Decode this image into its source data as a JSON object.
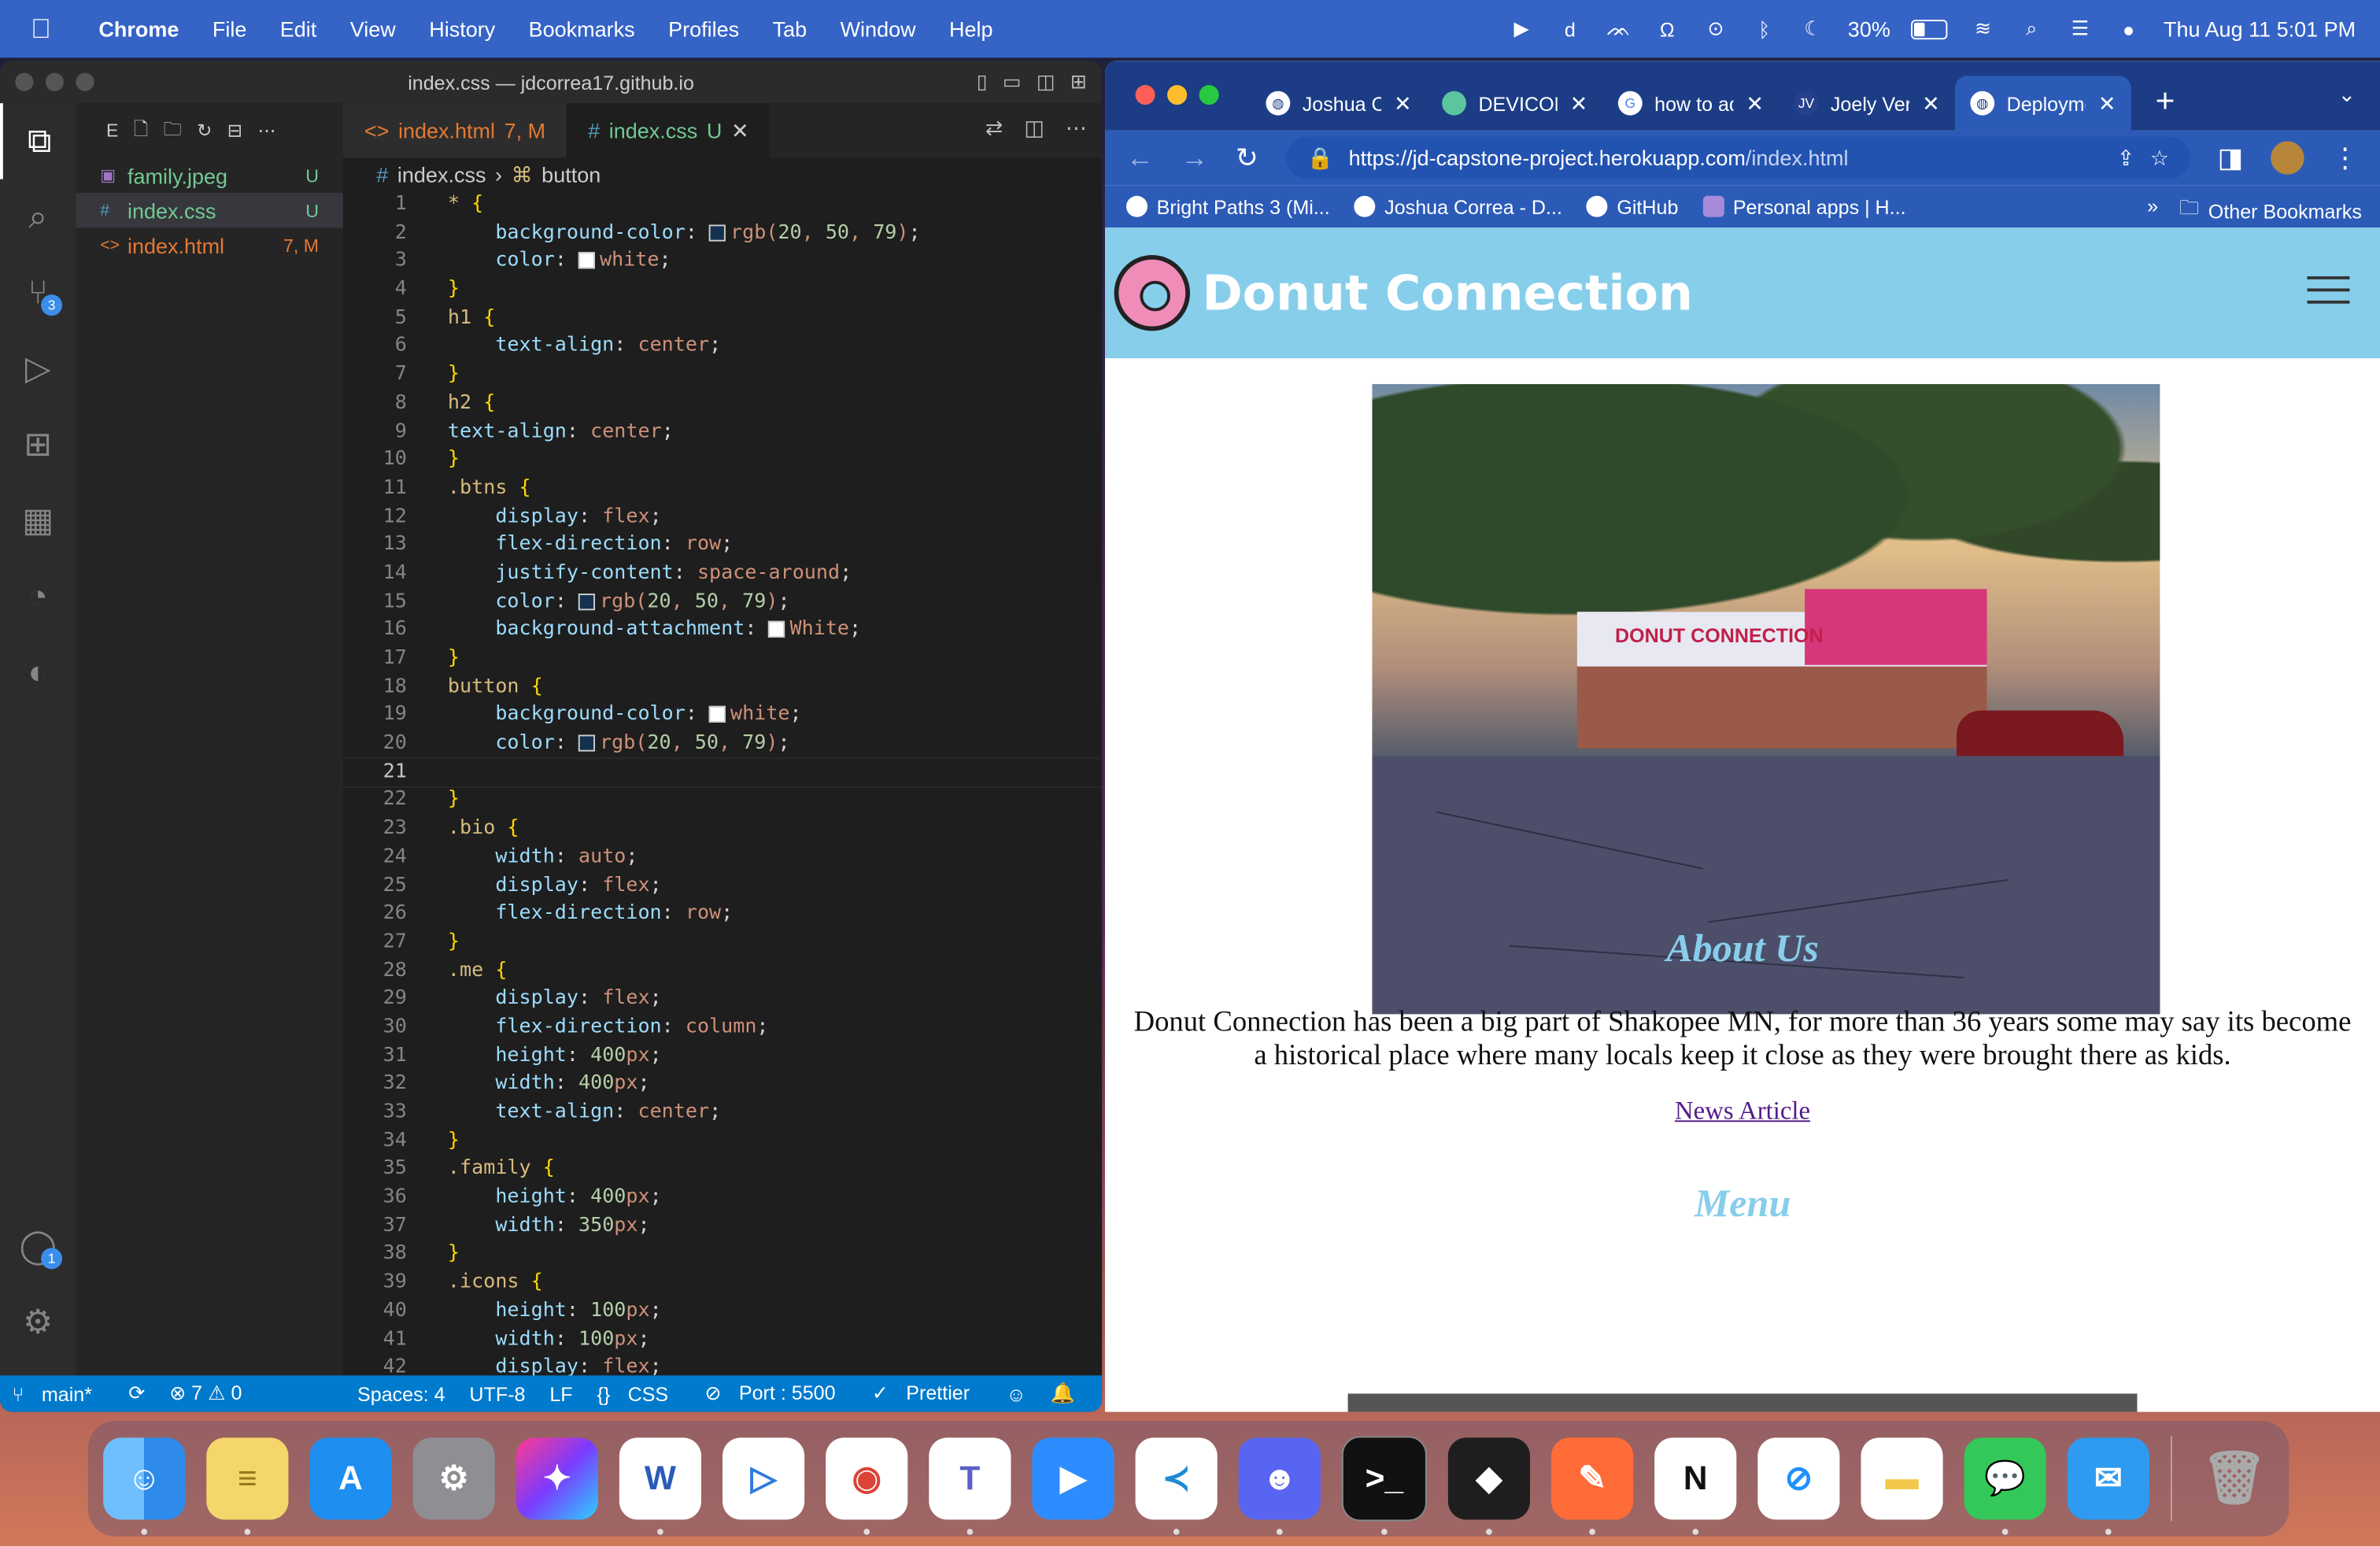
{
  "menubar": {
    "items": [
      "Chrome",
      "File",
      "Edit",
      "View",
      "History",
      "Bookmarks",
      "Profiles",
      "Tab",
      "Window",
      "Help"
    ],
    "battery": "30%",
    "datetime": "Thu Aug 11  5:01 PM"
  },
  "vscode": {
    "window_title": "index.css — jdcorrea17.github.io",
    "explorer_label": "E",
    "files": [
      {
        "name": "family.jpeg",
        "status": "U"
      },
      {
        "name": "index.css",
        "status": "U"
      },
      {
        "name": "index.html",
        "status": "7, M"
      }
    ],
    "tabs": [
      {
        "name": "index.html",
        "status": "7, M"
      },
      {
        "name": "index.css",
        "status": "U"
      }
    ],
    "breadcrumb": [
      "index.css",
      "button"
    ],
    "scm_badge": "3",
    "accounts_badge": "1",
    "code_lines": [
      "* {",
      "    background-color: rgb(20, 50, 79);",
      "    color: white;",
      "}",
      "h1 {",
      "    text-align: center;",
      "}",
      "h2 {",
      "text-align: center;",
      "}",
      ".btns {",
      "    display: flex;",
      "    flex-direction: row;",
      "    justify-content: space-around;",
      "    color: rgb(20, 50, 79);",
      "    background-attachment: White;",
      "}",
      "button {",
      "    background-color: white;",
      "    color: rgb(20, 50, 79);",
      "",
      "}",
      ".bio {",
      "    width: auto;",
      "    display: flex;",
      "    flex-direction: row;",
      "}",
      ".me {",
      "    display: flex;",
      "    flex-direction: column;",
      "    height: 400px;",
      "    width: 400px;",
      "    text-align: center;",
      "}",
      ".family {",
      "    height: 400px;",
      "    width: 350px;",
      "}",
      ".icons {",
      "    height: 100px;",
      "    width: 100px;",
      "    display: flex;"
    ],
    "current_line": 21,
    "status": {
      "branch": "main*",
      "problems": "⊗ 7 ⚠ 0",
      "spaces": "Spaces: 4",
      "encoding": "UTF-8",
      "eol": "LF",
      "language": "CSS",
      "port": "Port : 5500",
      "prettier": "Prettier"
    }
  },
  "chrome": {
    "tabs": [
      {
        "title": "Joshua C",
        "active": false
      },
      {
        "title": "DEVICON",
        "active": false
      },
      {
        "title": "how to ad",
        "active": false
      },
      {
        "title": "Joely Ver",
        "active": false
      },
      {
        "title": "Deployme",
        "active": true
      }
    ],
    "url_host": "https://jd-capstone-project.herokuapp.com",
    "url_path": "/index.html",
    "bookmarks": [
      "Bright Paths 3 (Mi...",
      "Joshua Correa - D...",
      "GitHub",
      "Personal apps | H..."
    ],
    "other_bookmarks": "Other Bookmarks",
    "more": "»"
  },
  "site": {
    "title": "Donut Connection",
    "about_heading": "About Us",
    "about_text": "Donut Connection has been a big part of Shakopee MN, for more than 36 years some may say its become a historical place where many locals keep it close as they were brought there as kids.",
    "news_link": "News Article",
    "menu_heading": "Menu",
    "hero_sign": "DONUT CONNECTION"
  },
  "dock": {
    "apps": [
      "finder",
      "stickies",
      "app-store",
      "system-preferences",
      "pixelmator",
      "word",
      "infuse",
      "chrome",
      "teams",
      "zoom",
      "vscode",
      "discord",
      "terminal",
      "figma",
      "postman",
      "notion",
      "safari",
      "notes",
      "messages",
      "mail",
      "trash"
    ]
  }
}
